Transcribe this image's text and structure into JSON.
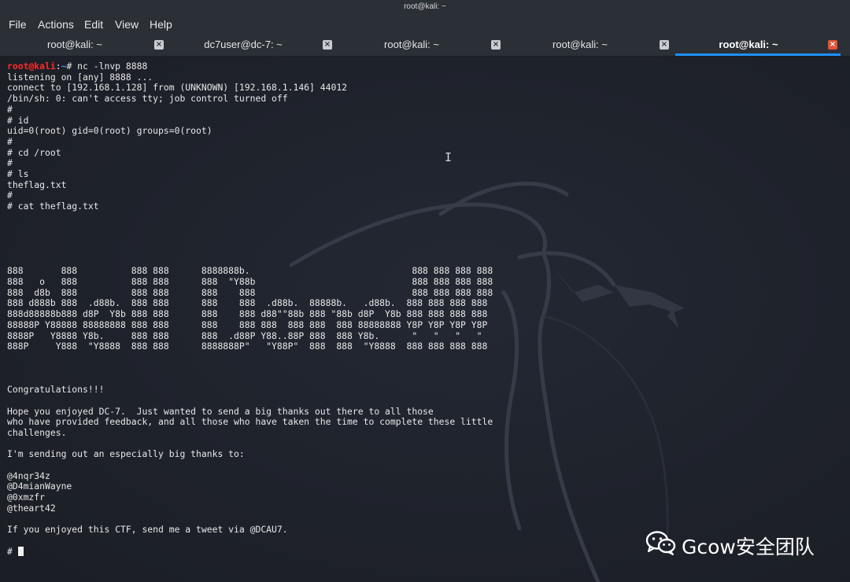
{
  "window": {
    "title": "root@kali: ~"
  },
  "menubar": {
    "items": [
      "File",
      "Actions",
      "Edit",
      "View",
      "Help"
    ]
  },
  "tabs": [
    {
      "label": "root@kali: ~",
      "active": false
    },
    {
      "label": "dc7user@dc-7: ~",
      "active": false
    },
    {
      "label": "root@kali: ~",
      "active": false
    },
    {
      "label": "root@kali: ~",
      "active": false
    },
    {
      "label": "root@kali: ~",
      "active": true
    }
  ],
  "terminal": {
    "prompt_user": "root@kali",
    "prompt_path": "~",
    "prompt_symbol": "# ",
    "command": "nc -lnvp 8888",
    "output": "listening on [any] 8888 ...\nconnect to [192.168.1.128] from (UNKNOWN) [192.168.1.146] 44012\n/bin/sh: 0: can't access tty; job control turned off\n#\n# id\nuid=0(root) gid=0(root) groups=0(root)\n#\n# cd /root\n#\n# ls\ntheflag.txt\n#\n# cat theflag.txt\n\n\n\n\n\n888       888          888 888      8888888b.                              888 888 888 888\n888   o   888          888 888      888  \"Y88b                             888 888 888 888\n888  d8b  888          888 888      888    888                             888 888 888 888\n888 d888b 888  .d88b.  888 888      888    888  .d88b.  88888b.   .d88b.  888 888 888 888\n888d88888b888 d8P  Y8b 888 888      888    888 d88\"\"88b 888 \"88b d8P  Y8b 888 888 888 888\n88888P Y88888 88888888 888 888      888    888 888  888 888  888 88888888 Y8P Y8P Y8P Y8P\n8888P   Y8888 Y8b.     888 888      888  .d88P Y88..88P 888  888 Y8b.      \"   \"   \"   \"\n888P     Y888  \"Y8888  888 888      8888888P\"   \"Y88P\"  888  888  \"Y8888  888 888 888 888\n\n\n\nCongratulations!!!\n\nHope you enjoyed DC-7.  Just wanted to send a big thanks out there to all those\nwho have provided feedback, and all those who have taken the time to complete these little\nchallenges.\n\nI'm sending out an especially big thanks to:\n\n@4nqr34z\n@D4mianWayne\n@0xmzfr\n@theart42\n\nIf you enjoyed this CTF, send me a tweet via @DCAU7.\n\n",
    "final_prompt": "# "
  },
  "watermark": {
    "text": "Gcow安全团队",
    "icon": "wechat-icon"
  },
  "colors": {
    "background": "#1e222b",
    "chrome": "#2b2f36",
    "prompt_user": "#ff2b2b",
    "prompt_path": "#4d8dff",
    "active_tab_underline": "#1e90ff",
    "active_tab_close": "#e25336"
  }
}
